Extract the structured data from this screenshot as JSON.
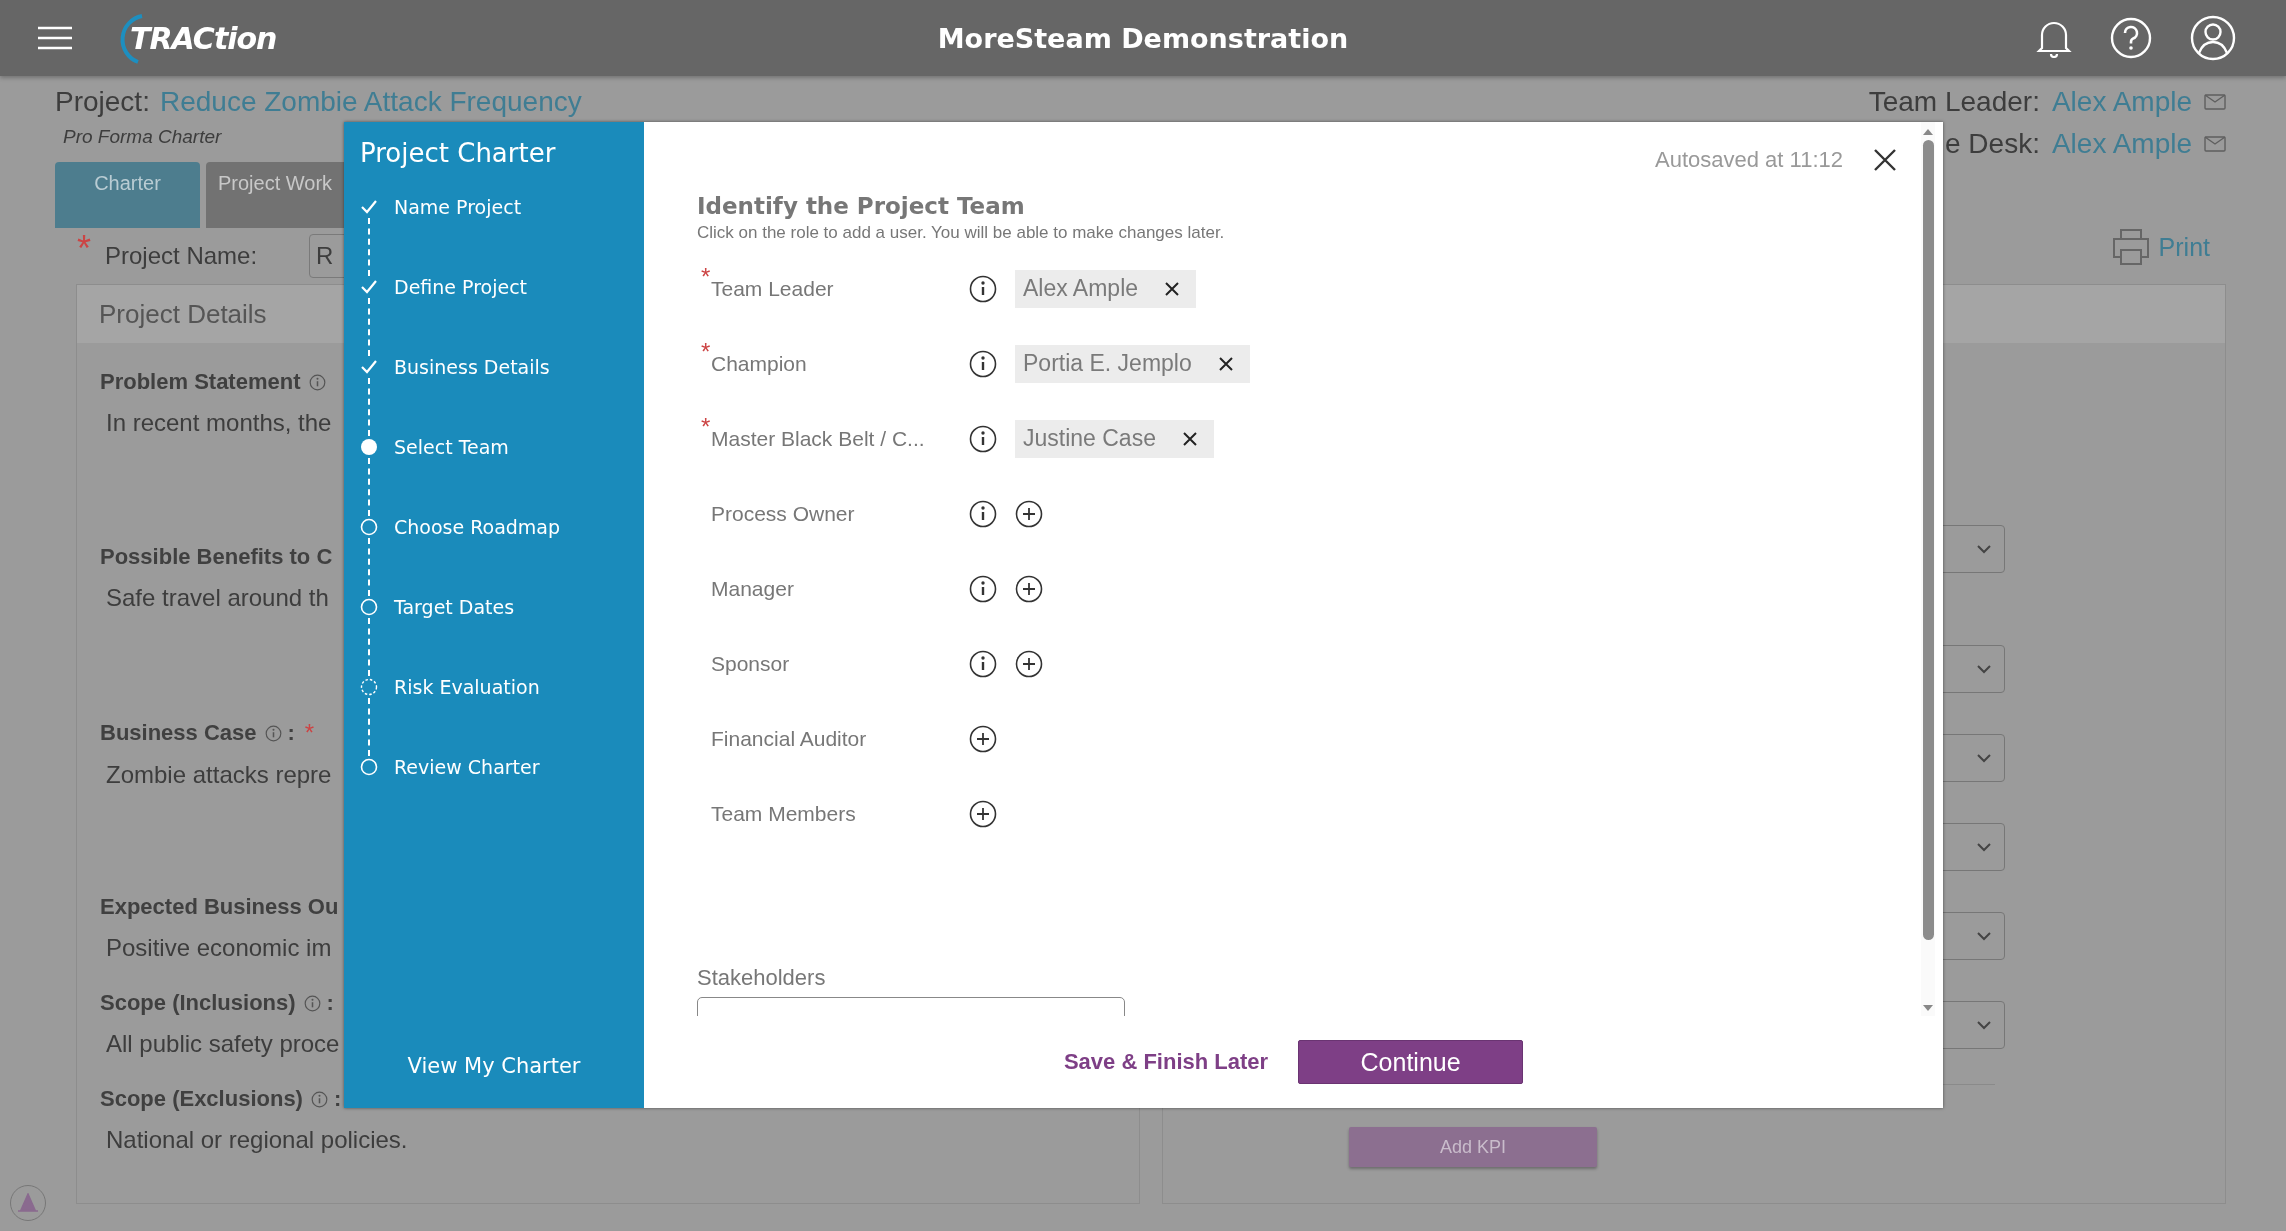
{
  "header": {
    "logo": "TRACtion",
    "title": "MoreSteam Demonstration"
  },
  "project": {
    "label": "Project:",
    "name": "Reduce Zombie Attack Frequency",
    "subtitle": "Pro Forma Charter"
  },
  "people": [
    {
      "label": "Team Leader:",
      "name": "Alex Ample"
    },
    {
      "label": "e Desk:",
      "name": "Alex Ample"
    }
  ],
  "tabs": [
    {
      "label": "Charter",
      "selected": true
    },
    {
      "label": "Project Work",
      "selected": false
    }
  ],
  "project_name": {
    "required_mark": "*",
    "label": "Project Name:",
    "value": "R"
  },
  "print": "Print",
  "details": {
    "title": "Project Details",
    "sections": [
      {
        "heading": "Problem Statement",
        "info": true,
        "text": "In recent months, the"
      },
      {
        "heading": "Possible Benefits to C",
        "info": false,
        "text": "Safe travel around th"
      },
      {
        "heading": "Business Case",
        "info": true,
        "after": ":",
        "required_mark": "*",
        "text": "Zombie attacks repre"
      },
      {
        "heading": "Expected Business Ou",
        "info": false,
        "text": "Positive economic im"
      },
      {
        "heading": "Scope (Inclusions)",
        "info": true,
        "after": ":",
        "text": "All public safety proce"
      },
      {
        "heading": "Scope (Exclusions)",
        "info": true,
        "after": ":",
        "text": "National or regional policies."
      }
    ]
  },
  "kpi_panel": {
    "selects": [
      {
        "kind": "select"
      },
      {
        "kind": "select"
      },
      {
        "kind": "select"
      },
      {
        "kind": "select"
      },
      {
        "kind": "select"
      },
      {
        "kind": "select"
      }
    ],
    "add_button": "Add KPI"
  },
  "modal": {
    "sidebar_title": "Project Charter",
    "steps": [
      {
        "label": "Name Project",
        "done": true,
        "selected": false
      },
      {
        "label": "Define Project",
        "done": true,
        "selected": false
      },
      {
        "label": "Business Details",
        "done": true,
        "selected": false
      },
      {
        "label": "Select Team",
        "selected": true
      },
      {
        "label": "Choose Roadmap",
        "done": false,
        "optional": false,
        "selected": false
      },
      {
        "label": "Target Dates",
        "done": false,
        "optional": false,
        "selected": false
      },
      {
        "label": "Risk Evaluation",
        "done": false,
        "optional": true,
        "selected": false
      },
      {
        "label": "Review Charter",
        "done": false,
        "optional": false,
        "selected": false
      }
    ],
    "view_link": "View My Charter",
    "autosaved": "Autosaved at 11:12",
    "heading": "Identify the Project Team",
    "instructions": "Click on the role to add a user. You will be able to make changes later.",
    "roles": [
      {
        "required_mark": "*",
        "label": "Team Leader",
        "info": true,
        "user": "Alex Ample"
      },
      {
        "required_mark": "*",
        "label": "Champion",
        "info": true,
        "user": "Portia E. Jemplo"
      },
      {
        "required_mark": "*",
        "label": "Master Black Belt / C...",
        "info": true,
        "user": "Justine Case"
      },
      {
        "label": "Process Owner",
        "info": true
      },
      {
        "label": "Manager",
        "info": true
      },
      {
        "label": "Sponsor",
        "info": true
      },
      {
        "label": "Financial Auditor",
        "info": false
      },
      {
        "label": "Team Members",
        "info": false
      }
    ],
    "stakeholders_label": "Stakeholders",
    "save_later": "Save & Finish Later",
    "continue": "Continue"
  }
}
